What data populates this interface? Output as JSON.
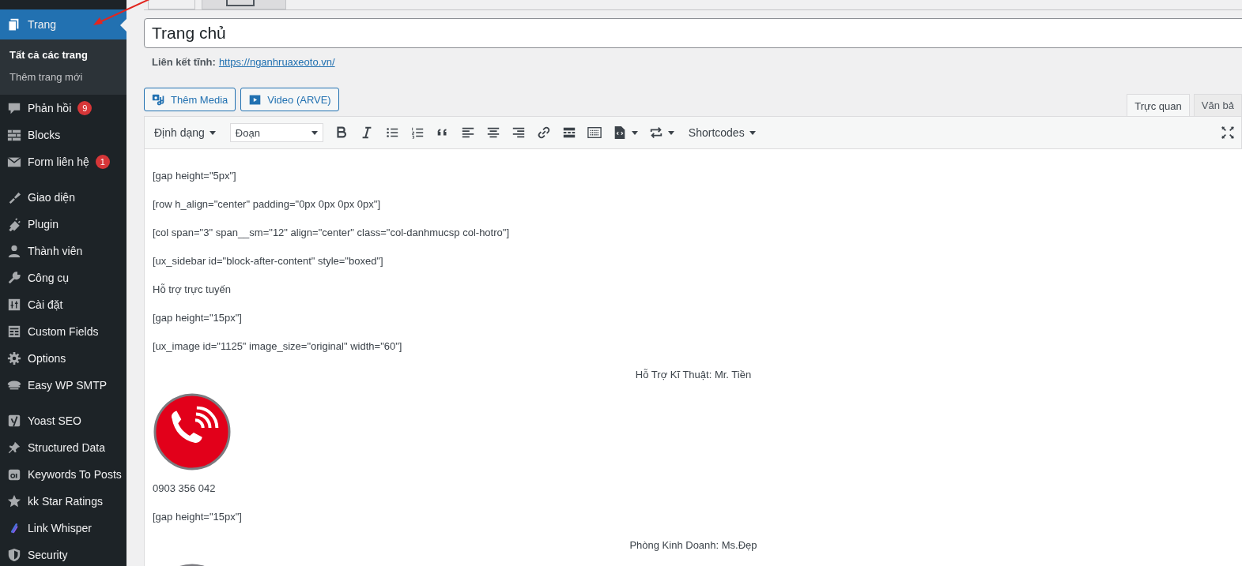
{
  "sidebar": {
    "groups": [
      [
        {
          "label": "Trang",
          "selected": true,
          "children": [
            {
              "label": "Tất cả các trang",
              "selected": true
            },
            {
              "label": "Thêm trang mới",
              "selected": false
            }
          ]
        },
        {
          "label": "Phản hồi",
          "badge": "9",
          "selected": false
        },
        {
          "label": "Blocks",
          "selected": false
        },
        {
          "label": "Form liên hệ",
          "badge": "1",
          "selected": false
        }
      ],
      [
        {
          "label": "Giao diện",
          "selected": false
        },
        {
          "label": "Plugin",
          "selected": false
        },
        {
          "label": "Thành viên",
          "selected": false
        },
        {
          "label": "Công cụ",
          "selected": false
        },
        {
          "label": "Cài đặt",
          "selected": false
        },
        {
          "label": "Custom Fields",
          "selected": false
        },
        {
          "label": "Options",
          "selected": false
        },
        {
          "label": "Easy WP SMTP",
          "selected": false
        }
      ],
      [
        {
          "label": "Yoast SEO",
          "selected": false
        },
        {
          "label": "Structured Data",
          "selected": false
        },
        {
          "label": "Keywords To Posts",
          "selected": false
        },
        {
          "label": "kk Star Ratings",
          "selected": false
        },
        {
          "label": "Link Whisper",
          "selected": false
        },
        {
          "label": "Security",
          "selected": false
        }
      ]
    ]
  },
  "top_tabs": [
    {
      "selected": true
    },
    {
      "selected": false
    }
  ],
  "title": {
    "value": "Trang chủ"
  },
  "permalink": {
    "label": "Liên kết tĩnh:",
    "url": "https://nganhruaxeoto.vn/"
  },
  "media_buttons": [
    "Thêm Media",
    "Video (ARVE)"
  ],
  "editor_tabs": [
    {
      "label": "Trực quan",
      "selected": true
    },
    {
      "label": "Văn bả",
      "selected": false
    }
  ],
  "toolbar": {
    "format_menu": "Định dạng",
    "block_select": "Đoạn",
    "shortcodes_menu": "Shortcodes"
  },
  "content": [
    {
      "kind": "text",
      "centered": false,
      "text": "[gap height=\"5px\"]"
    },
    {
      "kind": "text",
      "centered": false,
      "text": "[row h_align=\"center\" padding=\"0px 0px 0px 0px\"]"
    },
    {
      "kind": "text",
      "centered": false,
      "text": "[col span=\"3\" span__sm=\"12\" align=\"center\" class=\"col-danhmucsp col-hotro\"]"
    },
    {
      "kind": "text",
      "centered": false,
      "text": "[ux_sidebar id=\"block-after-content\" style=\"boxed\"]"
    },
    {
      "kind": "text",
      "centered": false,
      "text": "Hỗ trợ trực tuyến"
    },
    {
      "kind": "text",
      "centered": false,
      "text": "[gap height=\"15px\"]"
    },
    {
      "kind": "text",
      "centered": false,
      "text": "[ux_image id=\"1125\" image_size=\"original\" width=\"60\"]"
    },
    {
      "kind": "text",
      "centered": true,
      "text": "Hỗ Trợ Kĩ Thuật: Mr. Tiền"
    },
    {
      "kind": "image"
    },
    {
      "kind": "text",
      "centered": false,
      "text": "0903 356 042"
    },
    {
      "kind": "text",
      "centered": false,
      "text": "[gap height=\"15px\"]"
    },
    {
      "kind": "text",
      "centered": true,
      "text": "Phòng Kinh Doanh: Ms.Đẹp"
    },
    {
      "kind": "image"
    }
  ]
}
